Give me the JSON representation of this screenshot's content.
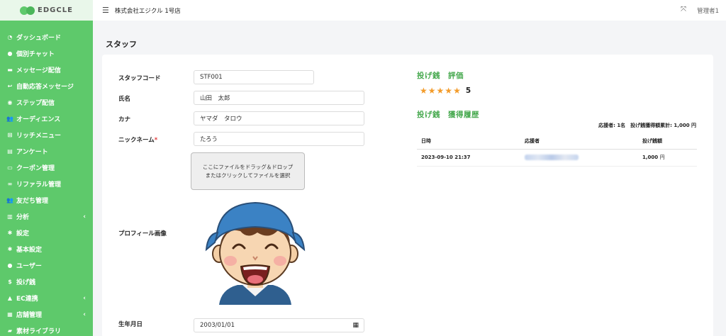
{
  "brand": {
    "logo_text": "EDGCLE"
  },
  "header": {
    "shop_name": "株式会社エジクル 1号店",
    "user": "管理者1"
  },
  "sidebar": {
    "items": [
      {
        "label": "ダッシュボード",
        "icon": "dashboard-icon",
        "glyph": "◔",
        "chevron": ""
      },
      {
        "label": "個別チャット",
        "icon": "chat-icon",
        "glyph": "●",
        "chevron": ""
      },
      {
        "label": "メッセージ配信",
        "icon": "message-icon",
        "glyph": "▬",
        "chevron": ""
      },
      {
        "label": "自動応答メッセージ",
        "icon": "reply-icon",
        "glyph": "↩",
        "chevron": ""
      },
      {
        "label": "ステップ配信",
        "icon": "step-icon",
        "glyph": "◉",
        "chevron": ""
      },
      {
        "label": "オーディエンス",
        "icon": "audience-icon",
        "glyph": "👥",
        "chevron": ""
      },
      {
        "label": "リッチメニュー",
        "icon": "rich-menu-icon",
        "glyph": "⊞",
        "chevron": ""
      },
      {
        "label": "アンケート",
        "icon": "survey-icon",
        "glyph": "▤",
        "chevron": ""
      },
      {
        "label": "クーポン管理",
        "icon": "coupon-icon",
        "glyph": "▭",
        "chevron": ""
      },
      {
        "label": "リファラル管理",
        "icon": "link-icon",
        "glyph": "∞",
        "chevron": ""
      },
      {
        "label": "友だち管理",
        "icon": "friends-icon",
        "glyph": "👥",
        "chevron": ""
      },
      {
        "label": "分析",
        "icon": "chart-icon",
        "glyph": "▥",
        "chevron": "‹"
      },
      {
        "label": "設定",
        "icon": "gear-icon",
        "glyph": "✱",
        "chevron": ""
      },
      {
        "label": "基本設定",
        "icon": "gear-icon",
        "glyph": "✱",
        "chevron": ""
      },
      {
        "label": "ユーザー",
        "icon": "user-icon",
        "glyph": "●",
        "chevron": ""
      },
      {
        "label": "投げ銭",
        "icon": "dollar-icon",
        "glyph": "$",
        "chevron": ""
      },
      {
        "label": "EC連携",
        "icon": "bag-icon",
        "glyph": "▲",
        "chevron": "‹"
      },
      {
        "label": "店舗管理",
        "icon": "store-icon",
        "glyph": "▦",
        "chevron": "‹"
      },
      {
        "label": "素材ライブラリ",
        "icon": "folder-icon",
        "glyph": "▰",
        "chevron": ""
      }
    ]
  },
  "page": {
    "title": "スタッフ"
  },
  "form": {
    "staff_code_label": "スタッフコード",
    "staff_code": "STF001",
    "name_label": "氏名",
    "name": "山田　太郎",
    "kana_label": "カナ",
    "kana": "ヤマダ　タロウ",
    "nickname_label": "ニックネーム",
    "required_mark": "*",
    "nickname": "たろう",
    "dropzone_line1": "ここにファイルをドラッグ＆ドロップ",
    "dropzone_line2": "またはクリックしてファイルを選択",
    "profile_image_label": "プロフィール画像",
    "birthday_label": "生年月日",
    "birthday": "2003/01/01"
  },
  "tips": {
    "rating_title": "投げ銭　評価",
    "rating_value": "5",
    "rating_stars": 5,
    "history_title": "投げ銭　獲得履歴",
    "summary": "応援者: 1名　投げ銭獲得額累計: 1,000 円",
    "columns": [
      "日時",
      "応援者",
      "投げ銭額"
    ],
    "rows": [
      {
        "datetime": "2023-09-10 21:37",
        "supporter_hidden": true,
        "amount": "1,000",
        "unit": "円"
      }
    ]
  },
  "colors": {
    "sidebar": "#5ec96b",
    "accent": "#47a94f",
    "star": "#f39c2b"
  }
}
